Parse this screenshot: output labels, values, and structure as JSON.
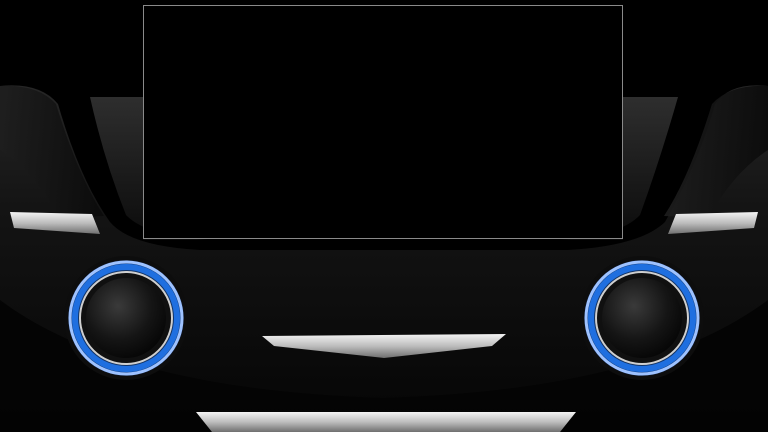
{
  "dashboard": {
    "accent_color": "#1f6fe0",
    "chrome_color": "#d9d9d9",
    "screen": {
      "state": "blank"
    },
    "controls": [
      {
        "name": "left-knob",
        "icon": "rotary-knob-icon"
      },
      {
        "name": "right-knob",
        "icon": "rotary-knob-icon"
      }
    ]
  }
}
